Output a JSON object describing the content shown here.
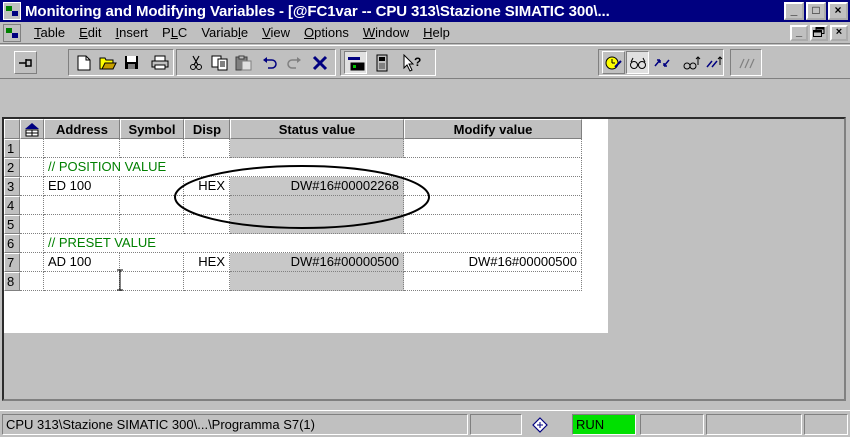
{
  "window": {
    "title": "Monitoring and Modifying Variables - [@FC1var -- CPU 313\\Stazione SIMATIC 300\\...",
    "buttons": [
      "_",
      "□",
      "×"
    ]
  },
  "menu": {
    "items": [
      {
        "label": "Table",
        "mnemonic_index": 0
      },
      {
        "label": "Edit",
        "mnemonic_index": 0
      },
      {
        "label": "Insert",
        "mnemonic_index": 0
      },
      {
        "label": "PLC",
        "mnemonic_index": 1
      },
      {
        "label": "Variable",
        "mnemonic_index": 6
      },
      {
        "label": "View",
        "mnemonic_index": 0
      },
      {
        "label": "Options",
        "mnemonic_index": 0
      },
      {
        "label": "Window",
        "mnemonic_index": 0
      },
      {
        "label": "Help",
        "mnemonic_index": 0
      }
    ],
    "doc_buttons": [
      "_",
      "ð",
      "×"
    ]
  },
  "toolbar": {
    "icons": [
      "pin-icon",
      "new-icon",
      "open-icon",
      "save-icon",
      "print-icon",
      "cut-icon",
      "copy-icon",
      "paste-icon",
      "undo-icon",
      "redo-icon",
      "delete-icon",
      "monitor-icon",
      "modify-icon",
      "help-cursor-icon",
      "trigger-icon",
      "watch-icon",
      "modify-value-icon",
      "watch-trigger-icon",
      "modify-trigger-icon",
      "enable-peripheral-icon"
    ]
  },
  "table": {
    "headers": [
      "Address",
      "Symbol",
      "Disp",
      "Status value",
      "Modify value"
    ],
    "rows": [
      {
        "num": "1",
        "address": "",
        "symbol": "",
        "disp": "",
        "status": "",
        "modify": "",
        "comment": false
      },
      {
        "num": "2",
        "address": "//  POSITION VALUE",
        "symbol": "",
        "disp": "",
        "status": "",
        "modify": "",
        "comment": true
      },
      {
        "num": "3",
        "address": "ED  100",
        "symbol": "",
        "disp": "HEX",
        "status": "DW#16#00002268",
        "modify": "",
        "comment": false
      },
      {
        "num": "4",
        "address": "",
        "symbol": "",
        "disp": "",
        "status": "",
        "modify": "",
        "comment": false
      },
      {
        "num": "5",
        "address": "",
        "symbol": "",
        "disp": "",
        "status": "",
        "modify": "",
        "comment": false
      },
      {
        "num": "6",
        "address": "//  PRESET VALUE",
        "symbol": "",
        "disp": "",
        "status": "",
        "modify": "",
        "comment": true
      },
      {
        "num": "7",
        "address": "AD  100",
        "symbol": "",
        "disp": "HEX",
        "status": "DW#16#00000500",
        "modify": "DW#16#00000500",
        "comment": false
      },
      {
        "num": "8",
        "address": "",
        "symbol": "",
        "disp": "",
        "status": "",
        "modify": "",
        "comment": false
      }
    ]
  },
  "statusbar": {
    "path": "CPU 313\\Stazione SIMATIC 300\\...\\Programma S7(1)",
    "mode": "RUN",
    "mode_color": "#00e000"
  },
  "colors": {
    "titlebar": "#000080",
    "comment": "#008000",
    "face": "#c0c0c0"
  }
}
